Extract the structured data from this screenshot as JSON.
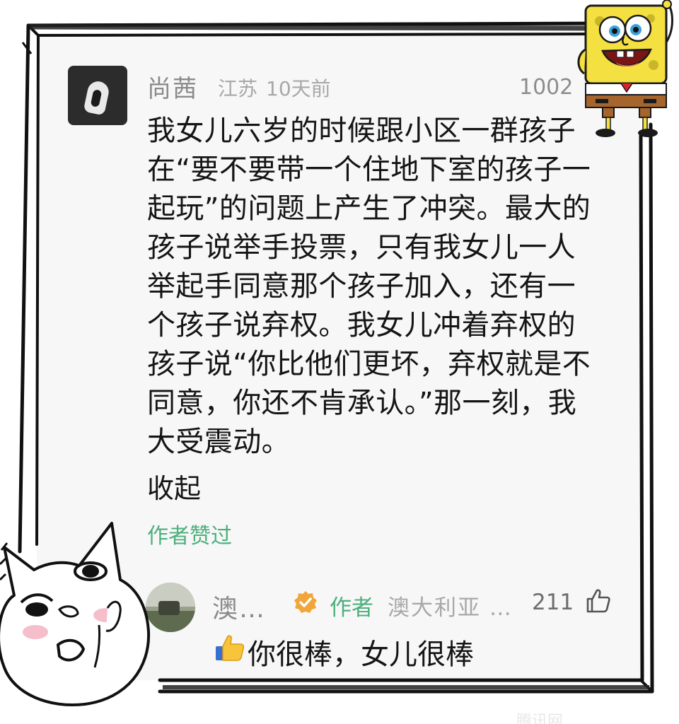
{
  "comment": {
    "user_name": "尚茜",
    "location": "江苏",
    "time_ago": "10天前",
    "like_count": "1002",
    "body_lines": [
      "我女儿六岁的时候跟小区一群孩子",
      "在“要不要带一个住地下室的孩子一",
      "起玩”的问题上产生了冲突。最大的",
      "孩子说举手投票，只有我女儿一人",
      "举起手同意那个孩子加入，还有一",
      "个孩子说弃权。我女儿冲着弃权的",
      "孩子说“你比他们更坏，弃权就是不",
      "同意，你还不肯承认。”那一刻，我",
      "大受震动。"
    ],
    "collapse_label": "收起",
    "author_liked_label": "作者赞过"
  },
  "reply": {
    "user_name": "澳…",
    "author_tag": "作者",
    "location": "澳大利亚 …",
    "like_count": "211",
    "text": "你很棒，女儿很棒"
  },
  "icons": {
    "author_badge": "check-badge-icon",
    "like": "thumbs-up-icon",
    "reply_emoji": "thumbs-up-emoji-icon"
  },
  "colors": {
    "accent_green": "#4caf7d",
    "badge_orange": "#f0a63a",
    "meta_gray": "#a8a8a8",
    "text_dark": "#151515"
  }
}
